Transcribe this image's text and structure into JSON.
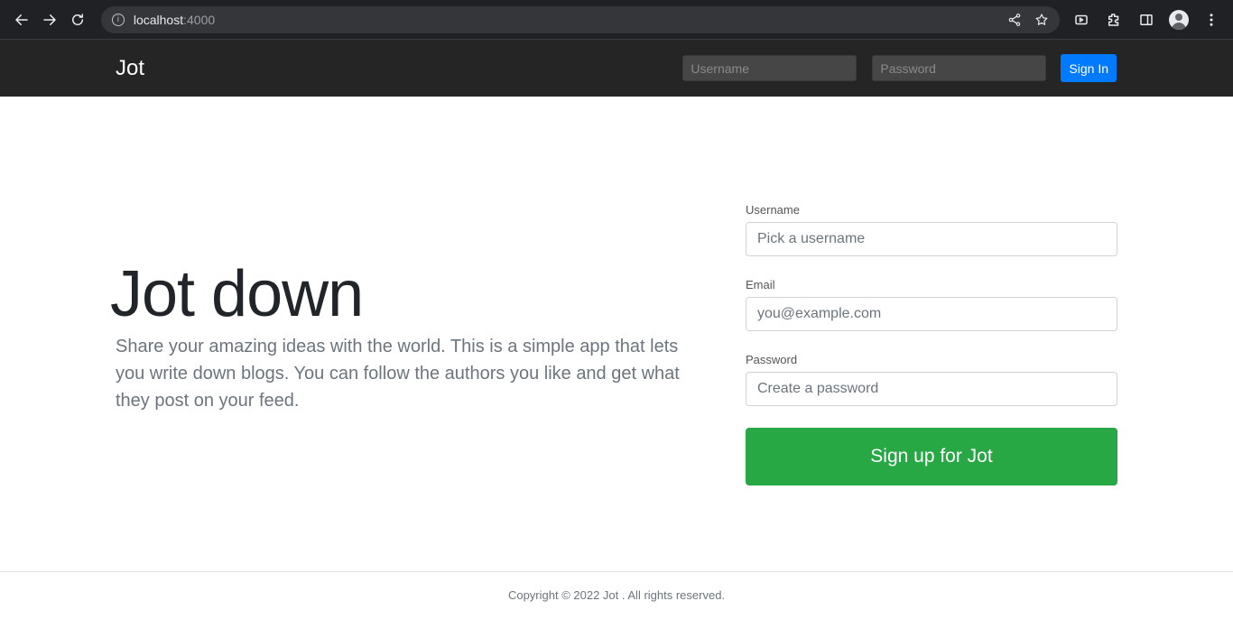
{
  "browser": {
    "url_host": "localhost",
    "url_port": ":4000",
    "icons": [
      "back-icon",
      "forward-icon",
      "reload-icon",
      "info-icon",
      "share-icon",
      "star-icon",
      "media-icon",
      "extensions-icon",
      "side-panel-icon",
      "profile-icon",
      "menu-icon"
    ]
  },
  "navbar": {
    "brand": "Jot",
    "username_placeholder": "Username",
    "password_placeholder": "Password",
    "signin_label": "Sign In",
    "signin_color": "#007bff"
  },
  "hero": {
    "title": "Jot down",
    "lead": "Share your amazing ideas with the world. This is a simple app that lets you write down blogs. You can follow the authors you like and get what they post on your feed."
  },
  "signup": {
    "username_label": "Username",
    "username_placeholder": "Pick a username",
    "email_label": "Email",
    "email_placeholder": "you@example.com",
    "password_label": "Password",
    "password_placeholder": "Create a password",
    "submit_label": "Sign up for Jot",
    "submit_color": "#28a745"
  },
  "footer": {
    "text": "Copyright © 2022 Jot . All rights reserved."
  }
}
